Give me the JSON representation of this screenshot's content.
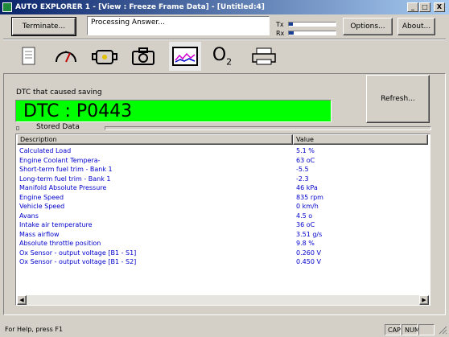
{
  "window": {
    "title": "AUTO EXPLORER 1 - [View : Freeze Frame Data] - [Untitled:4]",
    "controls": [
      "_",
      "□",
      "X"
    ]
  },
  "header": {
    "terminate_label": "Terminate...",
    "status_text": "Processing Answer...",
    "tx_label": "Tx",
    "rx_label": "Rx",
    "tx_level": 0.08,
    "rx_level": 0.1,
    "options_label": "Options...",
    "about_label": "About..."
  },
  "toolbar": {
    "tools": [
      "document-icon",
      "gauge-icon",
      "engine-icon",
      "camera-icon",
      "graph-icon",
      "o2-sensor-icon",
      "printer-icon"
    ],
    "active_tool": "graph-icon",
    "o2_label": "O",
    "o2_sub": "2"
  },
  "dtc": {
    "caption": "DTC that caused saving",
    "value": "DTC : P0443",
    "color": "#00ff00",
    "refresh_label": "Refresh..."
  },
  "stored": {
    "label": "Stored Data",
    "columns": [
      "Description",
      "Value"
    ],
    "rows": [
      {
        "desc": "Calculated Load",
        "value": " 5.1 %"
      },
      {
        "desc": "Engine Coolant Tempera-",
        "value": "63 oC"
      },
      {
        "desc": "Short-term fuel trim - Bank 1",
        "value": "-5.5"
      },
      {
        "desc": "Long-term fuel trim - Bank 1",
        "value": "-2.3"
      },
      {
        "desc": "Manifold Absolute Pressure",
        "value": "46 kPa"
      },
      {
        "desc": "Engine Speed",
        "value": "835 rpm"
      },
      {
        "desc": "Vehicle Speed",
        "value": "0 km/h"
      },
      {
        "desc": "Avans",
        "value": "4.5 o"
      },
      {
        "desc": "Intake air temperature",
        "value": "36 oC"
      },
      {
        "desc": "Mass airflow",
        "value": "3.51 g/s"
      },
      {
        "desc": "Absolute throttle position",
        "value": " 9.8 %"
      },
      {
        "desc": "Ox Sensor - output voltage [B1 - S1]",
        "value": "0.260 V"
      },
      {
        "desc": "Ox Sensor - output voltage [B1 - S2]",
        "value": "0.450 V"
      }
    ],
    "row_color": "#0000cc"
  },
  "statusbar": {
    "help": "For Help, press F1",
    "cap": "CAP",
    "num": "NUM"
  }
}
